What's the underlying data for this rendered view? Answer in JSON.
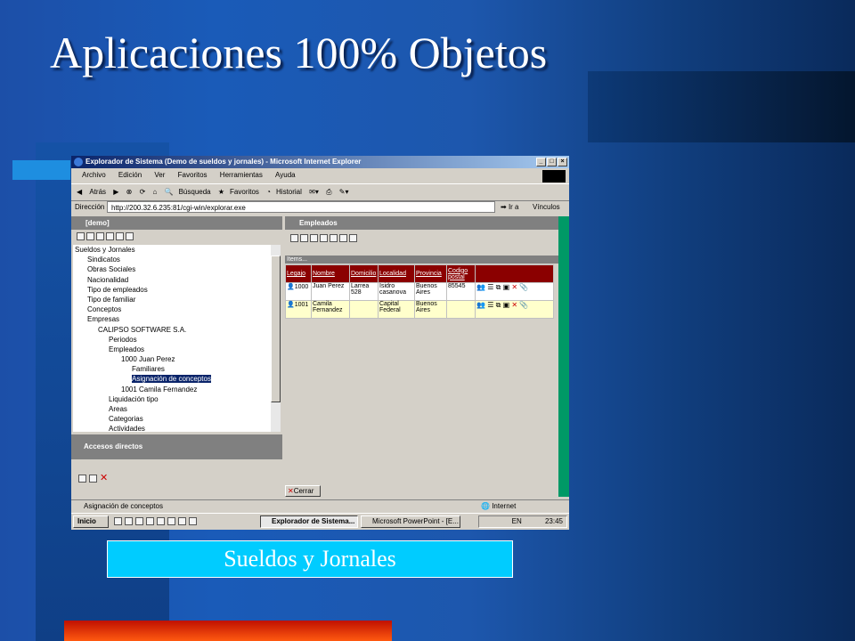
{
  "slide": {
    "title": "Aplicaciones 100% Objetos",
    "caption": "Sueldos y Jornales"
  },
  "window": {
    "title": "Explorador de Sistema (Demo de sueldos y jornales) - Microsoft Internet Explorer",
    "menu": [
      "Archivo",
      "Edición",
      "Ver",
      "Favoritos",
      "Herramientas",
      "Ayuda"
    ],
    "toolbar": {
      "back": "Atrás",
      "search": "Búsqueda",
      "favorites": "Favoritos",
      "history": "Historial"
    },
    "address": {
      "label": "Dirección",
      "url": "http://200.32.6.235:81/cgi-win/explorar.exe",
      "go": "Ir a",
      "links": "Vínculos"
    }
  },
  "left_pane": {
    "header": "[demo]",
    "tree": [
      "Sueldos y Jornales",
      "Sindicatos",
      "Obras Sociales",
      "Nacionalidad",
      "Tipo de empleados",
      "Tipo de familiar",
      "Conceptos",
      "Empresas",
      "CALIPSO SOFTWARE S.A.",
      "Periodos",
      "Empleados",
      "1000 Juan Perez",
      "Familiares",
      "Asignación de conceptos",
      "1001 Camila Fernandez",
      "Liquidación tipo",
      "Areas",
      "Categorias",
      "Actividades"
    ],
    "shortcuts_header": "Accesos directos"
  },
  "right_pane": {
    "header": "Empleados",
    "items_label": "Items...",
    "columns": [
      "Legajo",
      "Nombre",
      "Domicilio",
      "Localidad",
      "Provincia",
      "Codigo postal"
    ],
    "rows": [
      {
        "legajo": "1000",
        "nombre": "Juan Perez",
        "domicilio": "Larrea 528",
        "localidad": "Isidro casanova",
        "provincia": "Buenos Aires",
        "cp": "85545"
      },
      {
        "legajo": "1001",
        "nombre": "Camila Fernandez",
        "domicilio": "",
        "localidad": "Capital Federal",
        "provincia": "Buenos Aires",
        "cp": ""
      }
    ],
    "close_button": "Cerrar"
  },
  "statusbar": {
    "left": "Asignación de conceptos",
    "zone": "Internet"
  },
  "taskbar": {
    "start": "Inicio",
    "tasks": [
      "Explorador de Sistema...",
      "Microsoft PowerPoint - [E..."
    ],
    "lang": "EN",
    "clock": "23:45"
  },
  "colors": {
    "header_red": "#8b0000",
    "caption_bg": "#00ccff",
    "green_strip": "#009966"
  }
}
